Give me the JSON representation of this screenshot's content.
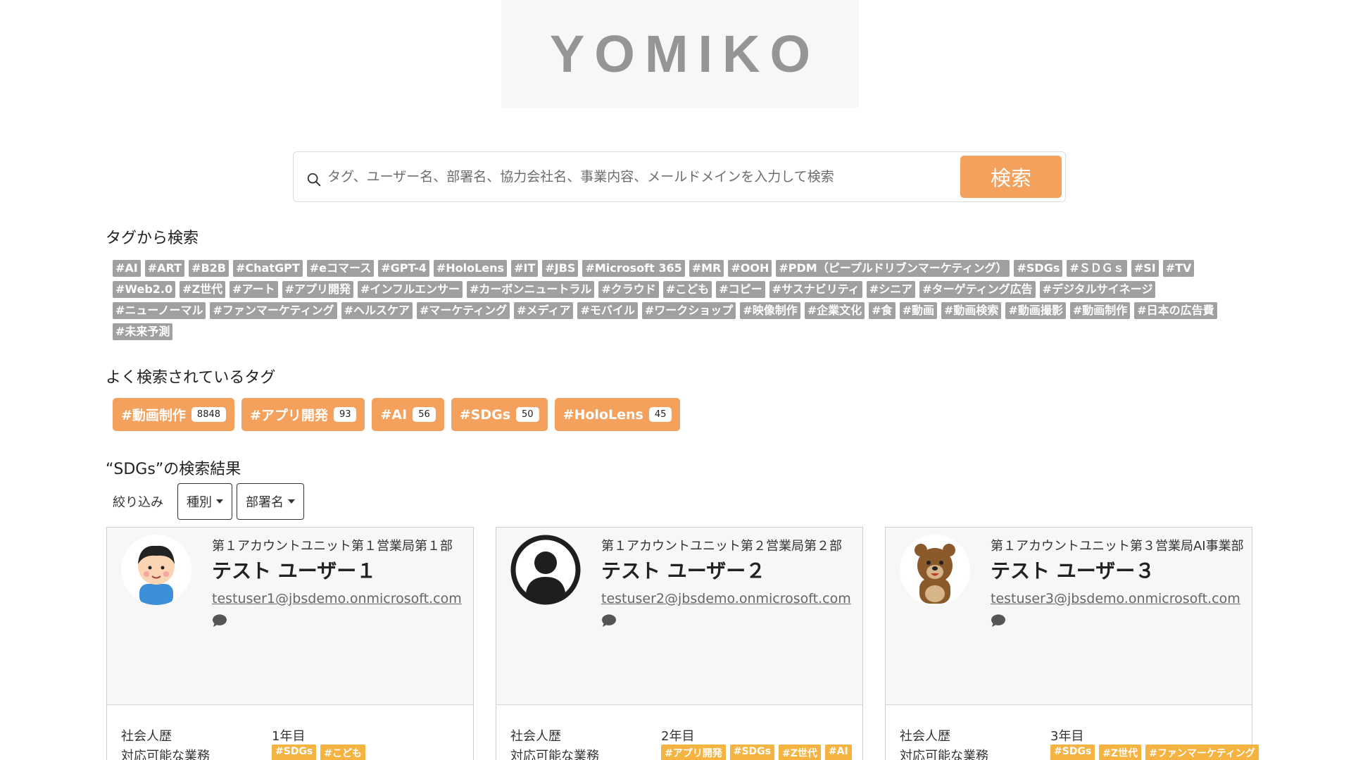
{
  "logo": {
    "text": "YOMIKO"
  },
  "search": {
    "placeholder": "タグ、ユーザー名、部署名、協力会社名、事業内容、メールドメインを入力して検索",
    "button_label": "検索"
  },
  "tag_section": {
    "title": "タグから検索",
    "tags": [
      "#AI",
      "#ART",
      "#B2B",
      "#ChatGPT",
      "#eコマース",
      "#GPT-4",
      "#HoloLens",
      "#IT",
      "#JBS",
      "#Microsoft 365",
      "#MR",
      "#OOH",
      "#PDM（ピープルドリブンマーケティング）",
      "#SDGs",
      "#ＳＤＧｓ",
      "#SI",
      "#TV",
      "#Web2.0",
      "#Z世代",
      "#アート",
      "#アプリ開発",
      "#インフルエンサー",
      "#カーボンニュートラル",
      "#クラウド",
      "#こども",
      "#コピー",
      "#サスナビリティ",
      "#シニア",
      "#ターゲティング広告",
      "#デジタルサイネージ",
      "#ニューノーマル",
      "#ファンマーケティング",
      "#ヘルスケア",
      "#マーケティング",
      "#メディア",
      "#モバイル",
      "#ワークショップ",
      "#映像制作",
      "#企業文化",
      "#食",
      "#動画",
      "#動画検索",
      "#動画撮影",
      "#動画制作",
      "#日本の広告費",
      "#未来予測"
    ]
  },
  "popular_section": {
    "title": "よく検索されているタグ",
    "tags": [
      {
        "label": "#動画制作",
        "count": "8848"
      },
      {
        "label": "#アプリ開発",
        "count": "93"
      },
      {
        "label": "#AI",
        "count": "56"
      },
      {
        "label": "#SDGs",
        "count": "50"
      },
      {
        "label": "#HoloLens",
        "count": "45"
      }
    ]
  },
  "results": {
    "title": "“SDGs”の検索結果",
    "filter_label": "絞り込み",
    "filter_type": "種別",
    "filter_dept": "部署名",
    "label_career": "社会人歴",
    "label_skills": "対応可能な業務",
    "cards": [
      {
        "dept": "第１アカウントユニット第１営業局第１部",
        "name": "テスト ユーザー１",
        "email": "testuser1@jbsdemo.onmicrosoft.com",
        "career": "1年目",
        "skills": [
          "#SDGs",
          "#こども"
        ],
        "avatar": "boy-avatar-icon"
      },
      {
        "dept": "第１アカウントユニット第２営業局第２部",
        "name": "テスト ユーザー２",
        "email": "testuser2@jbsdemo.onmicrosoft.com",
        "career": "2年目",
        "skills": [
          "#アプリ開発",
          "#SDGs",
          "#Z世代",
          "#AI"
        ],
        "avatar": "default-user-icon"
      },
      {
        "dept": "第１アカウントユニット第３営業局AI事業部",
        "name": "テスト ユーザー３",
        "email": "testuser3@jbsdemo.onmicrosoft.com",
        "career": "3年目",
        "skills": [
          "#SDGs",
          "#Z世代",
          "#ファンマーケティング"
        ],
        "avatar": "bear-avatar-icon"
      }
    ]
  },
  "colors": {
    "accent": "#f4a15d",
    "tag_gray": "#a0a0a0",
    "skill_tag": "#f5b342"
  }
}
